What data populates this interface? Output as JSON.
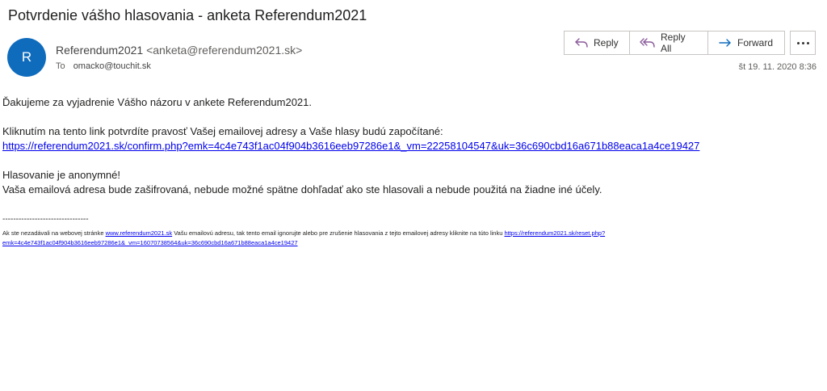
{
  "message": {
    "subject": "Potvrdenie vášho hlasovania - anketa Referendum2021",
    "avatar_letter": "R",
    "sender_name": "Referendum2021",
    "sender_email": "<anketa@referendum2021.sk>",
    "to_label": "To",
    "to_value": "omacko@touchit.sk",
    "date": "št 19. 11. 2020 8:36"
  },
  "actions": {
    "reply": "Reply",
    "reply_all": "Reply All",
    "forward": "Forward"
  },
  "body": {
    "line1": "Ďakujeme za vyjadrenie Vášho názoru v ankete Referendum2021.",
    "line2": "Kliknutím na tento link potvrdíte pravosť Vašej emailovej adresy a Vaše hlasy budú započítané:",
    "confirm_link": "https://referendum2021.sk/confirm.php?emk=4c4e743f1ac04f904b3616eeb97286e1&_vm=22258104547&uk=36c690cbd16a671b88eaca1a4ce19427",
    "line3": "Hlasovanie je anonymné!",
    "line4": "Vaša emailová adresa bude zašifrovaná, nebude možné spätne dohľadať ako ste hlasovali a nebude použitá na žiadne iné účely."
  },
  "footer": {
    "rule": "--------------------------------",
    "text_before": "Ak ste nezadávali na webovej stránke ",
    "site_link": "www.referendum2021.sk",
    "text_after": " Vašu emailovú adresu, tak tento email ignorujte alebo pre zrušenie hlasovania z tejto emailovej adresy kliknite na túto linku ",
    "reset_link_part1": "https://referendum2021.sk/reset.php?",
    "reset_link_part2": "emk=4c4e743f1ac04f904b3616eeb97286e1&_vm=16070738564&uk=36c690cbd16a671b88eaca1a4ce19427"
  },
  "colors": {
    "avatar": "#0f6cbd",
    "link": "#0000ee",
    "icon_accent": "#8a5a9a",
    "forward_icon": "#0f6cbd"
  }
}
